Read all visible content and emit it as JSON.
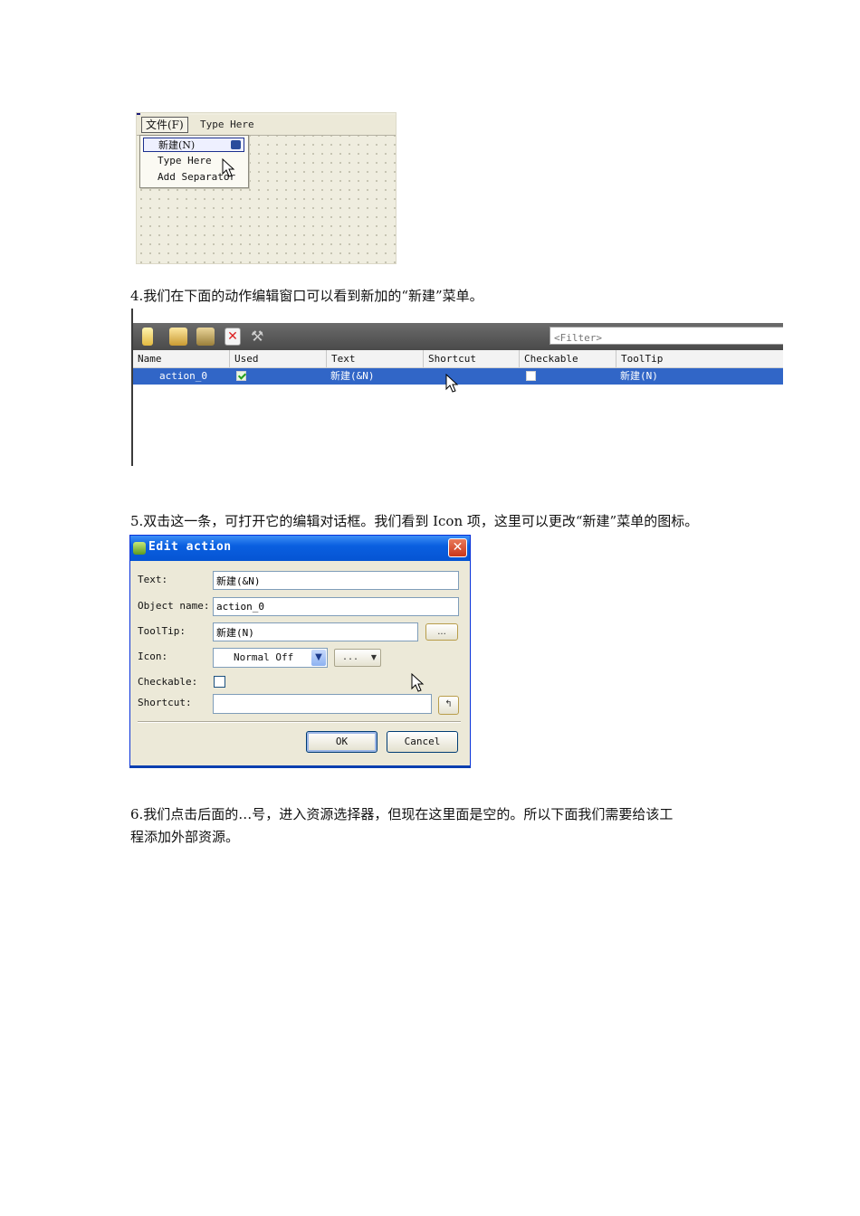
{
  "menu_designer": {
    "menubar": {
      "file_menu": "文件(F)",
      "type_here": "Type Here"
    },
    "dropdown": {
      "new_item": "新建(N)",
      "type_here": "Type Here",
      "add_separator": "Add Separator"
    }
  },
  "paragraphs": {
    "p4": "4.我们在下面的动作编辑窗口可以看到新加的“新建”菜单。",
    "p5": "5.双击这一条，可打开它的编辑对话框。我们看到 Icon 项，这里可以更改“新建”菜单的图标。",
    "p6_line1": "6.我们点击后面的…号，进入资源选择器，但现在这里面是空的。所以下面我们需要给该工",
    "p6_line2": "程添加外部资源。"
  },
  "action_editor": {
    "filter_placeholder": "<Filter>",
    "columns": [
      "Name",
      "Used",
      "Text",
      "Shortcut",
      "Checkable",
      "ToolTip"
    ],
    "rows": [
      {
        "name": "action_0",
        "used": true,
        "text": "新建(&N)",
        "shortcut": "",
        "checkable": false,
        "tooltip": "新建(N)"
      }
    ],
    "selection_color": "#3166c7"
  },
  "edit_dialog": {
    "title": "Edit action",
    "labels": {
      "text": "Text:",
      "object_name": "Object name:",
      "tooltip": "ToolTip:",
      "icon": "Icon:",
      "checkable": "Checkable:",
      "shortcut": "Shortcut:"
    },
    "values": {
      "text": "新建(&N)",
      "object_name": "action_0",
      "tooltip": "新建(N)",
      "icon_mode": "Normal Off",
      "shortcut": ""
    },
    "ellipsis": "...",
    "checkable_checked": false,
    "buttons": {
      "ok": "OK",
      "cancel": "Cancel"
    },
    "titlebar_color": "#0a5fe0"
  }
}
